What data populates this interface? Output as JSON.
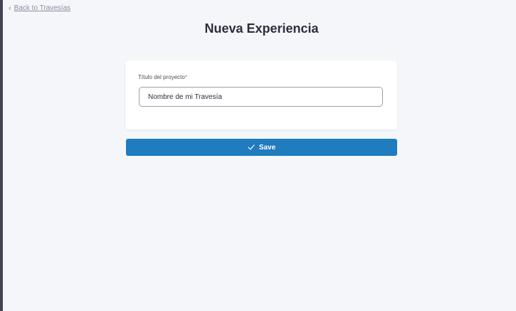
{
  "back_link": {
    "label": "Back to Travesías"
  },
  "page": {
    "title": "Nueva Experiencia"
  },
  "form": {
    "title_label": "Título del proyecto",
    "required_mark": "*",
    "title_value": "Nombre de mi Travesía"
  },
  "actions": {
    "save_label": "Save"
  },
  "colors": {
    "accent": "#1f7cbf",
    "background": "#f5f6fa",
    "required": "#d9534f"
  },
  "icons": {
    "back": "chevron-left-icon",
    "save": "check-icon"
  }
}
